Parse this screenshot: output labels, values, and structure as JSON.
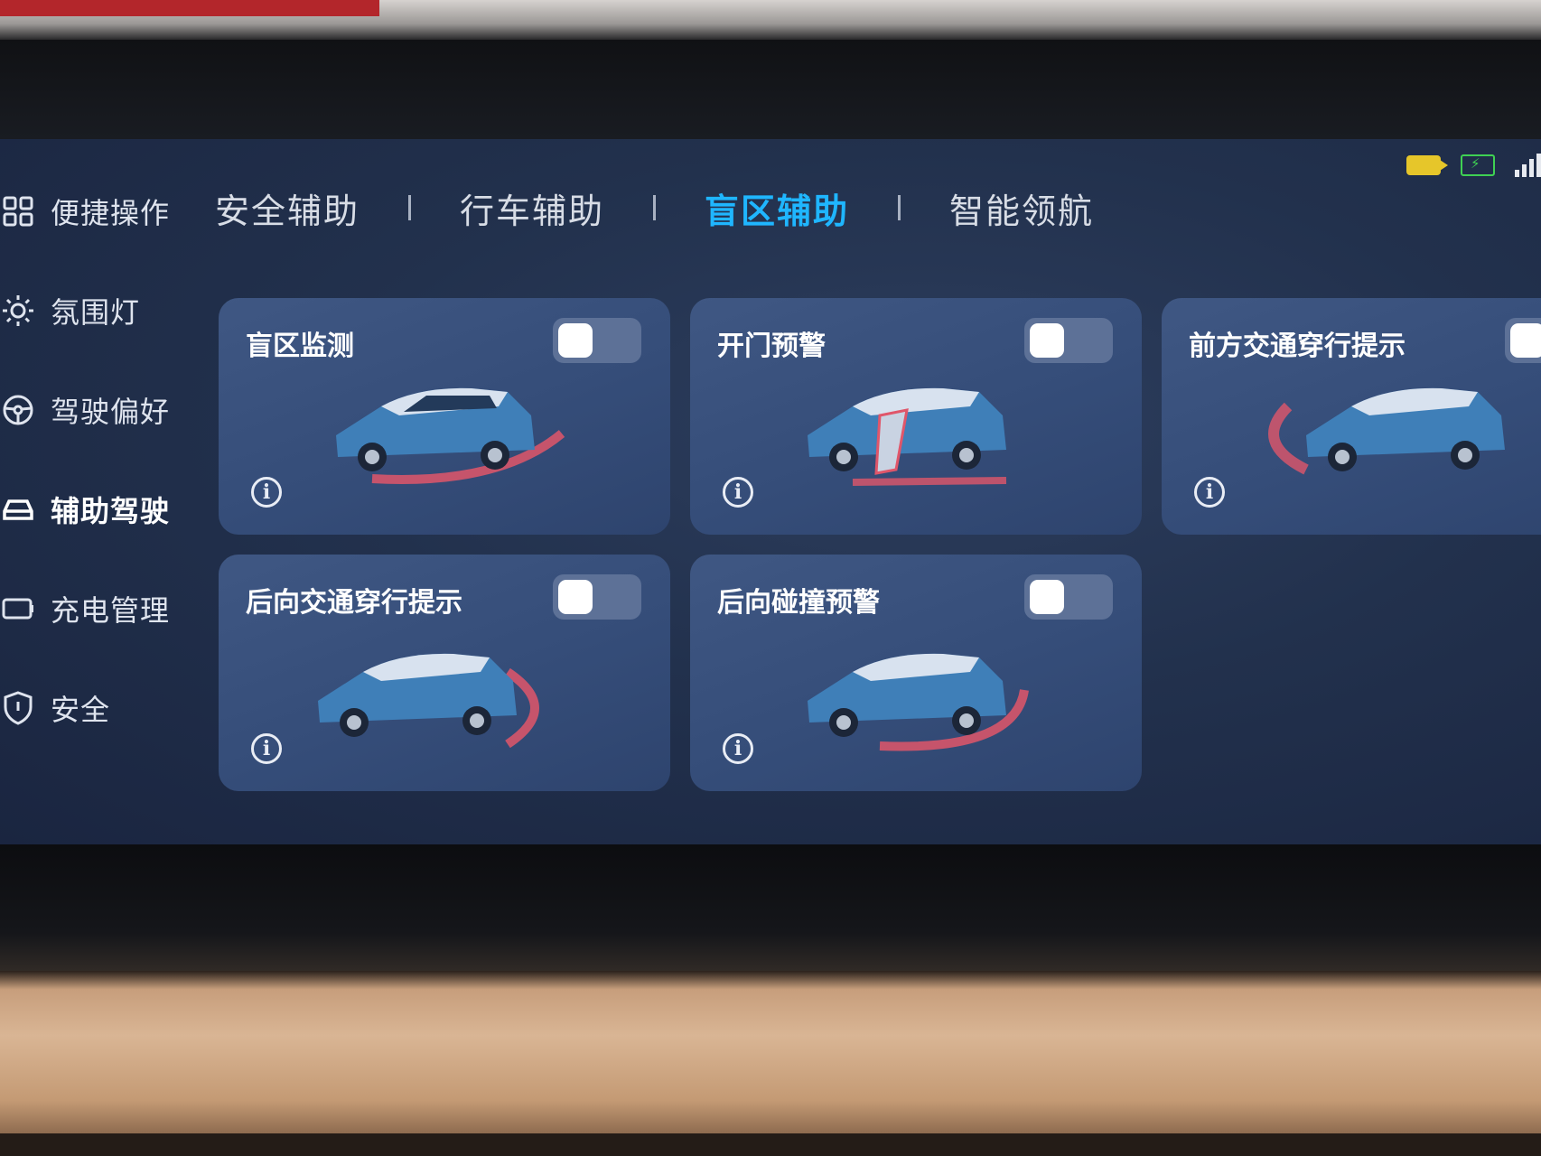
{
  "sidebar": {
    "items": [
      {
        "label": "便捷操作",
        "icon": "grid-icon"
      },
      {
        "label": "氛围灯",
        "icon": "sun-icon"
      },
      {
        "label": "驾驶偏好",
        "icon": "steering-wheel-icon"
      },
      {
        "label": "辅助驾驶",
        "icon": "car-icon",
        "active": true
      },
      {
        "label": "充电管理",
        "icon": "battery-icon"
      },
      {
        "label": "安全",
        "icon": "shield-icon"
      }
    ]
  },
  "tabs": [
    {
      "label": "安全辅助"
    },
    {
      "label": "行车辅助"
    },
    {
      "label": "盲区辅助",
      "active": true
    },
    {
      "label": "智能领航"
    }
  ],
  "cards": [
    {
      "title": "盲区监测",
      "toggle": "off"
    },
    {
      "title": "开门预警",
      "toggle": "off"
    },
    {
      "title": "前方交通穿行提示",
      "toggle": "off"
    },
    {
      "title": "后向交通穿行提示",
      "toggle": "off"
    },
    {
      "title": "后向碰撞预警",
      "toggle": "off"
    }
  ],
  "status_bar": {
    "icons": [
      "camera-icon",
      "battery-charging-icon",
      "signal-icon"
    ]
  },
  "colors": {
    "accent": "#1fb6ff",
    "warning_arc": "#e0566a",
    "card_bg": "#3a5180",
    "screen_bg": "#22314d"
  }
}
